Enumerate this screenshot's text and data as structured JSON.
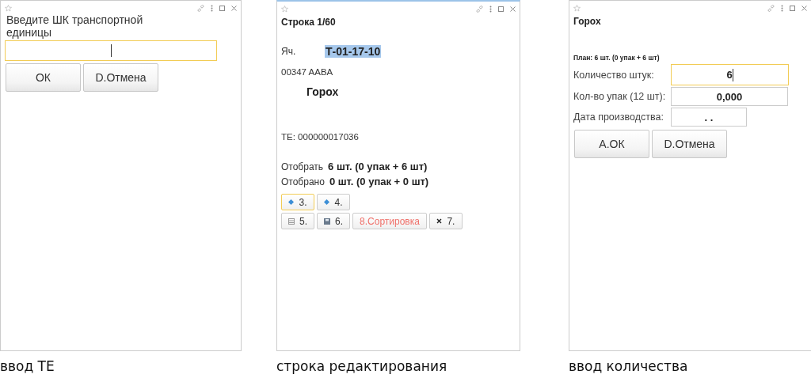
{
  "screens": [
    {
      "kind": "barcode",
      "caption": "ввод ТЕ",
      "prompt": "Введите ШК транспортной единицы",
      "field": {
        "focused": true
      },
      "buttons": [
        {
          "label": "ОК",
          "focused": false
        },
        {
          "label": "D.Отмена",
          "focused": false
        }
      ]
    },
    {
      "kind": "line",
      "caption": "строка редактирования",
      "title": "Строка 1/60",
      "cell": {
        "label": "Яч.",
        "value": "Т-01-17-10",
        "selected": true
      },
      "code": "00347 AABA",
      "product": "Горох",
      "unit": "ТЕ: 000000017036",
      "amounts": [
        {
          "label": "Отобрать",
          "value": "6 шт. (0 упак + 6 шт)"
        },
        {
          "label": "Отобрано",
          "value": "0 шт. (0 упак + 0 шт)"
        }
      ],
      "button_rows": [
        [
          {
            "label": "3.",
            "kind": "diamond",
            "focused": true
          },
          {
            "label": "4.",
            "kind": "diamond",
            "focused": false
          }
        ],
        [
          {
            "label": "5.",
            "kind": "table",
            "focused": false
          },
          {
            "label": "6.",
            "kind": "disk",
            "focused": false
          },
          {
            "label": "8.Сортировка",
            "kind": "plain",
            "focused": false,
            "color": "#f0706a"
          },
          {
            "label": "7.",
            "kind": "cross",
            "focused": false
          }
        ]
      ]
    },
    {
      "kind": "quantity",
      "caption": "ввод количества",
      "title": "Горох",
      "plan": "План: 6 шт. (0 упак + 6 шт)",
      "fields": [
        {
          "label": "Количество штук:",
          "value": "6",
          "focused": true
        },
        {
          "label": "Кол-во упак (12 шт):",
          "value": "0,000",
          "focused": false
        },
        {
          "label": "Дата производства:",
          "value": ". .",
          "focused": false
        }
      ],
      "buttons": [
        {
          "label": "А.ОК",
          "focused": false
        },
        {
          "label": "D.Отмена",
          "focused": false
        }
      ]
    }
  ]
}
